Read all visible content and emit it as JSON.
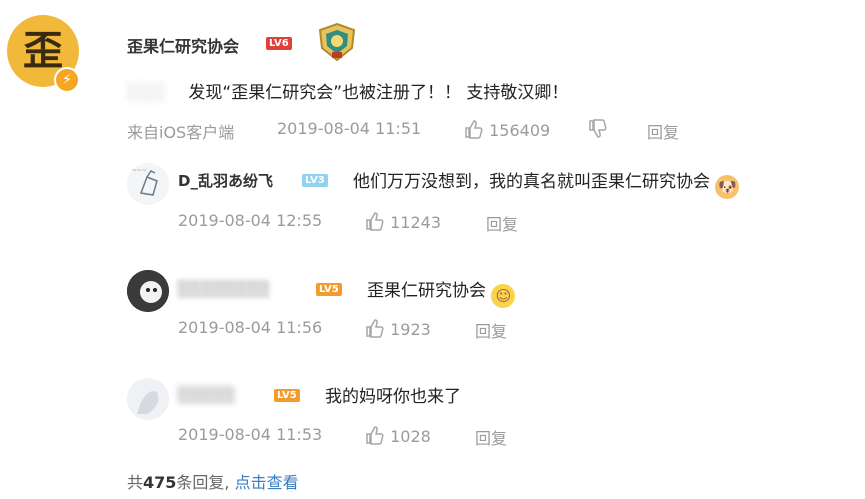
{
  "post": {
    "avatar_glyph": "歪",
    "verified_glyph": "⚡",
    "author": "歪果仁研究协会",
    "level": "LV6",
    "text_blurred": "░░░",
    "text": "发现“歪果仁研究会”也被注册了！！ 支持敬汉卿！",
    "source": "来自iOS客户端",
    "time": "2019-08-04 11:51",
    "likes": "156409",
    "reply_label": "回复"
  },
  "replies": [
    {
      "name": "D_乱羽あ纷飞",
      "level": "LV3",
      "text": "他们万万没想到，我的真名就叫歪果仁研究协会",
      "emoji": "doge-emoji",
      "time": "2019-08-04 12:55",
      "likes": "11243",
      "reply_label": "回复"
    },
    {
      "name": "░░░░░░░░",
      "level": "LV5",
      "text": "歪果仁研究协会",
      "emoji": "blush-emoji",
      "time": "2019-08-04 11:56",
      "likes": "1923",
      "reply_label": "回复"
    },
    {
      "name": "░░░░░",
      "level": "LV5",
      "text": "我的妈呀你也来了",
      "time": "2019-08-04 11:53",
      "likes": "1028",
      "reply_label": "回复"
    }
  ],
  "summary": {
    "prefix": "共",
    "count": "475",
    "suffix": "条回复,",
    "link": "点击查看"
  },
  "colors": {
    "level_red": "#e0403a",
    "level_orange": "#f39c2c",
    "level_blue": "#8fd3ef",
    "link": "#3b7ec1",
    "avatar_bg": "#f2b83a"
  }
}
